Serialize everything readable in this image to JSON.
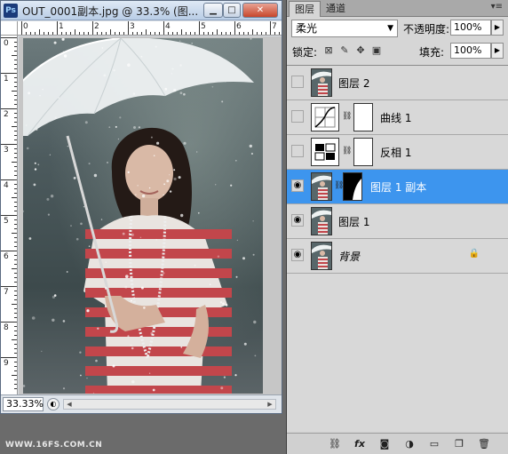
{
  "document": {
    "title": "OUT_0001副本.jpg @ 33.3% (图...",
    "app_icon": "Ps",
    "controls": {
      "minimize": "▁",
      "maximize": "□",
      "close": "✕"
    },
    "ruler_top_labels": [
      "0",
      "1",
      "2",
      "3",
      "4",
      "5",
      "6",
      "7"
    ],
    "ruler_left_labels": [
      "0",
      "1",
      "2",
      "3",
      "4",
      "5",
      "6",
      "7",
      "8",
      "9"
    ],
    "zoom": "33.33%"
  },
  "watermark": "WWW.16FS.COM.CN",
  "layers_panel": {
    "tabs": [
      {
        "label": "图层",
        "active": true
      },
      {
        "label": "通道",
        "active": false
      }
    ],
    "menu_glyph": "▾≡",
    "blend_mode": "柔光",
    "opacity_label": "不透明度:",
    "opacity_value": "100%",
    "lock_label": "锁定:",
    "fill_label": "填充:",
    "fill_value": "100%",
    "layers": [
      {
        "name": "图层 2",
        "visible": false,
        "kind": "photo",
        "mask": false,
        "selected": false,
        "locked": false,
        "italic": false
      },
      {
        "name": "曲线 1",
        "visible": false,
        "kind": "curves",
        "mask": true,
        "selected": false,
        "locked": false,
        "italic": false
      },
      {
        "name": "反相 1",
        "visible": false,
        "kind": "invert",
        "mask": true,
        "selected": false,
        "locked": false,
        "italic": false
      },
      {
        "name": "图层 1 副本",
        "visible": true,
        "kind": "photo",
        "mask": true,
        "selected": true,
        "locked": false,
        "italic": false
      },
      {
        "name": "图层 1",
        "visible": true,
        "kind": "photo",
        "mask": false,
        "selected": false,
        "locked": false,
        "italic": false
      },
      {
        "name": "背景",
        "visible": true,
        "kind": "photo",
        "mask": false,
        "selected": false,
        "locked": true,
        "italic": true
      }
    ],
    "bottom_icons": [
      "link-layers",
      "fx",
      "add-mask",
      "adjustment",
      "new-group",
      "new-layer",
      "delete"
    ]
  }
}
